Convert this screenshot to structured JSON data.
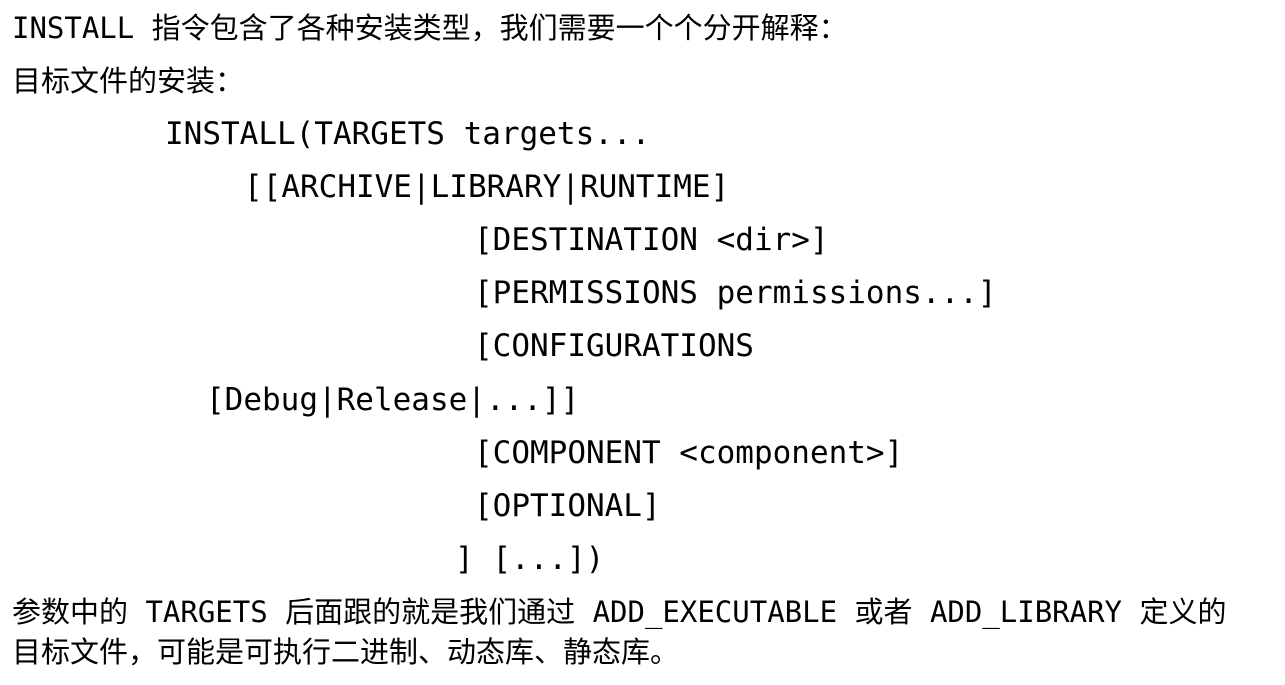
{
  "document": {
    "intro": "INSTALL 指令包含了各种安装类型，我们需要一个个分开解释：",
    "subheading": "目标文件的安装：",
    "code_lines": [
      "INSTALL(TARGETS targets...",
      "[[ARCHIVE|LIBRARY|RUNTIME]",
      "[DESTINATION <dir>]",
      "[PERMISSIONS permissions...]",
      "[CONFIGURATIONS",
      "[Debug|Release|...]]",
      "[COMPONENT <component>]",
      "[OPTIONAL]",
      "] [...])"
    ],
    "explanation_line1": "参数中的 TARGETS 后面跟的就是我们通过 ADD_EXECUTABLE 或者 ADD_LIBRARY 定义的",
    "explanation_line2": "目标文件，可能是可执行二进制、动态库、静态库。"
  }
}
